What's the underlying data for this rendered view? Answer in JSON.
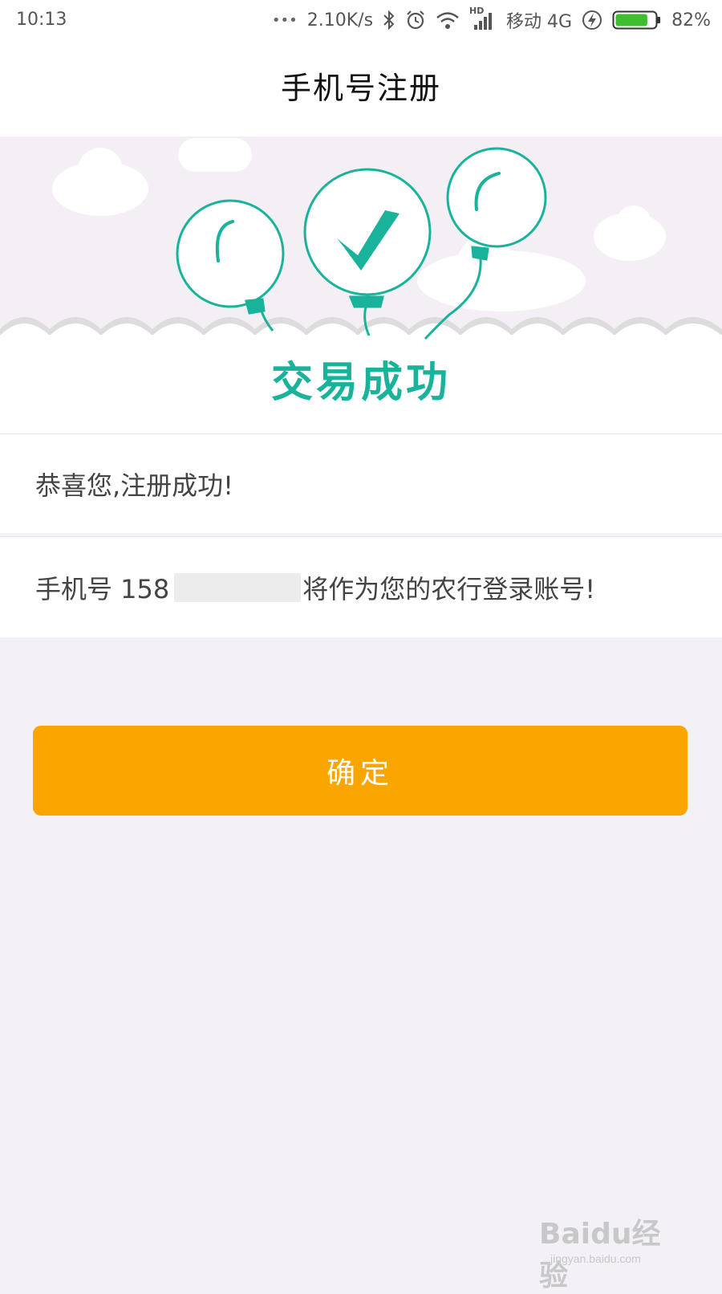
{
  "status_bar": {
    "time": "10:13",
    "dots": "•••",
    "network_speed": "2.10K/s",
    "hd_label": "HD",
    "carrier": "移动 4G",
    "battery_percent": "82%",
    "battery_level": 0.82,
    "icons": [
      "bluetooth-icon",
      "alarm-icon",
      "wifi-icon",
      "signal-icon",
      "charging-icon",
      "battery-icon"
    ]
  },
  "header": {
    "title": "手机号注册"
  },
  "banner": {
    "status_text": "交易成功",
    "accent_color": "#19b39b"
  },
  "message": {
    "congrats": "恭喜您,注册成功!",
    "phone_prefix": "手机号 158",
    "phone_suffix": "将作为您的农行登录账号!"
  },
  "confirm_button": {
    "label": "确定",
    "color": "#fba500"
  },
  "watermark": {
    "brand": "Baidu经验",
    "url": "jingyan.baidu.com"
  }
}
